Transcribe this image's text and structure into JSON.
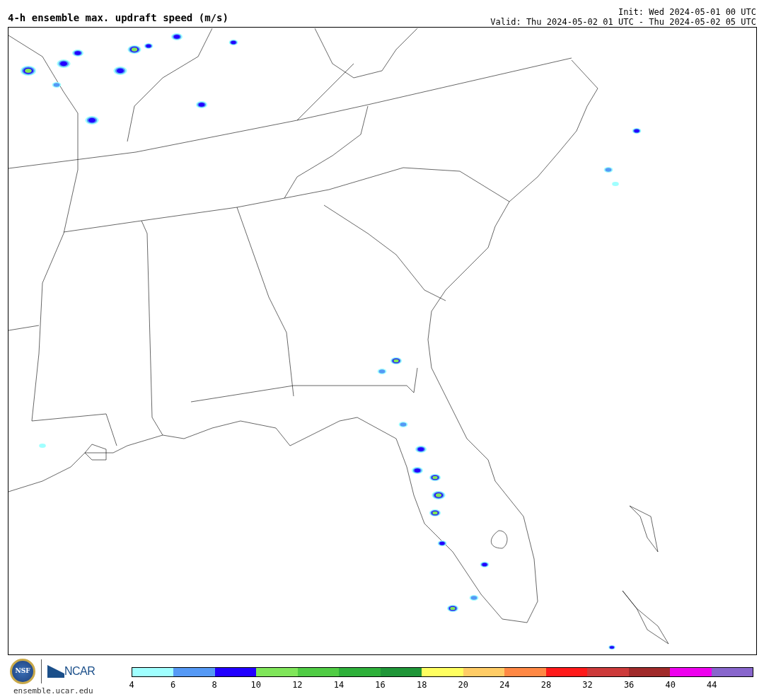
{
  "title": "4-h ensemble max. updraft speed (m/s)",
  "init": "Init: Wed 2024-05-01 00 UTC",
  "valid": "Valid: Thu 2024-05-02 01 UTC - Thu 2024-05-02 05 UTC",
  "logo": {
    "seal_text": "NSF",
    "org_text": "NCAR",
    "url": "ensemble.ucar.edu"
  },
  "colorbar": {
    "segments": [
      {
        "color": "#a0ffff"
      },
      {
        "color": "#5599f5"
      },
      {
        "color": "#2200ff"
      },
      {
        "color": "#80e65a"
      },
      {
        "color": "#50cc44"
      },
      {
        "color": "#2eb03a"
      },
      {
        "color": "#1f9638"
      },
      {
        "color": "#ffff60"
      },
      {
        "color": "#ffcc66"
      },
      {
        "color": "#ff8844"
      },
      {
        "color": "#ff1a1a"
      },
      {
        "color": "#cc3a3a"
      },
      {
        "color": "#a02a2a"
      },
      {
        "color": "#ee00ee"
      },
      {
        "color": "#8866cc"
      }
    ],
    "labels": [
      "4",
      "6",
      "8",
      "10",
      "12",
      "14",
      "16",
      "18",
      "20",
      "24",
      "28",
      "32",
      "36",
      "40",
      "44"
    ]
  }
}
